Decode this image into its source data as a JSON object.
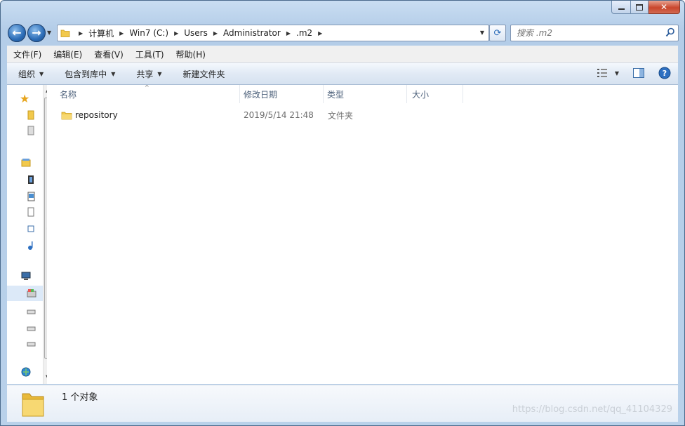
{
  "window": {
    "caption_buttons": [
      "minimize",
      "maximize",
      "close"
    ]
  },
  "nav": {
    "breadcrumb": [
      "计算机",
      "Win7 (C:)",
      "Users",
      "Administrator",
      ".m2"
    ],
    "search_placeholder": "搜索 .m2"
  },
  "menubar": {
    "items": [
      "文件(F)",
      "编辑(E)",
      "查看(V)",
      "工具(T)",
      "帮助(H)"
    ]
  },
  "toolbar": {
    "organize": "组织",
    "include_in_library": "包含到库中",
    "share": "共享",
    "new_folder": "新建文件夹"
  },
  "columns": {
    "name": "名称",
    "date_modified": "修改日期",
    "type": "类型",
    "size": "大小"
  },
  "files": [
    {
      "name": "repository",
      "date": "2019/5/14 21:48",
      "type": "文件夹",
      "size": ""
    }
  ],
  "status": {
    "count": "1 个对象"
  },
  "watermark": "https://blog.csdn.net/qq_41104329",
  "colors": {
    "window_frame": "#b9d1ea",
    "folder_yellow": "#f2c94c",
    "header_text": "#4c607a"
  }
}
